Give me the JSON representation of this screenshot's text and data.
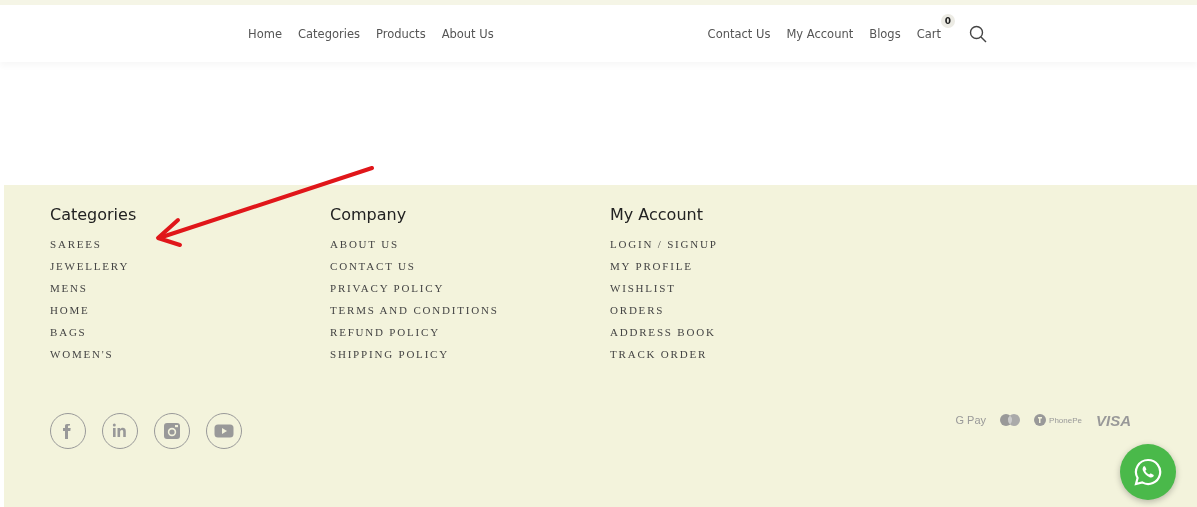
{
  "header": {
    "nav_left": [
      "Home",
      "Categories",
      "Products",
      "About Us"
    ],
    "nav_right": [
      "Contact Us",
      "My Account",
      "Blogs",
      "Cart"
    ],
    "cart_count": "0"
  },
  "footer": {
    "columns": [
      {
        "heading": "Categories",
        "links": [
          "SAREES",
          "JEWELLERY",
          "MENS",
          "HOME",
          "BAGS",
          "WOMEN'S"
        ]
      },
      {
        "heading": "Company",
        "links": [
          "ABOUT US",
          "CONTACT US",
          "PRIVACY POLICY",
          "TERMS AND CONDITIONS",
          "REFUND POLICY",
          "SHIPPING POLICY"
        ]
      },
      {
        "heading": "My Account",
        "links": [
          "LOGIN / SIGNUP",
          "MY PROFILE",
          "WISHLIST",
          "ORDERS",
          "ADDRESS BOOK",
          "TRACK ORDER"
        ]
      }
    ],
    "social": [
      {
        "kind": "facebook"
      },
      {
        "kind": "linkedin"
      },
      {
        "kind": "instagram"
      },
      {
        "kind": "youtube"
      }
    ],
    "payments": [
      {
        "kind": "gpay",
        "label": "G Pay"
      },
      {
        "kind": "mastercard"
      },
      {
        "kind": "phonepe",
        "label": "PhonePe"
      },
      {
        "kind": "visa",
        "label": "VISA"
      }
    ]
  }
}
